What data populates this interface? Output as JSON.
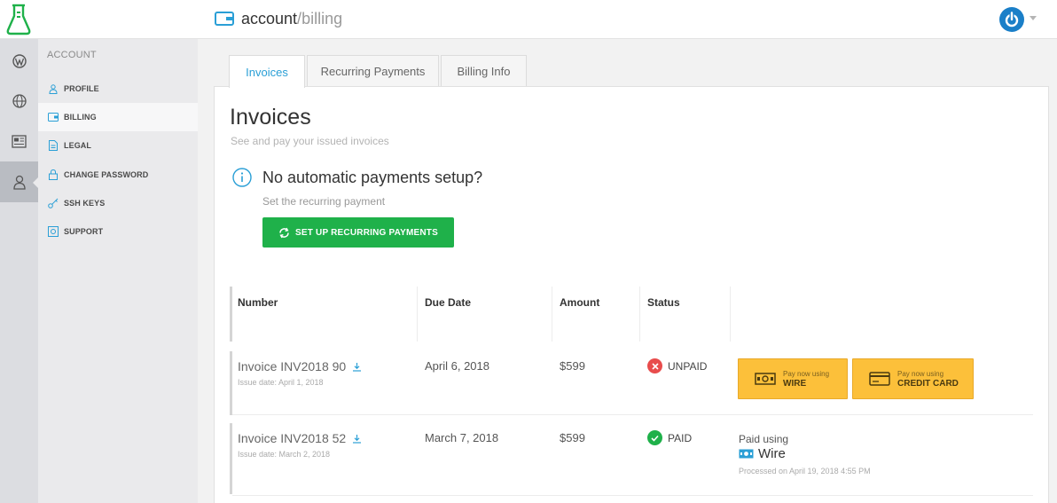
{
  "header": {
    "breadcrumb_main": "account",
    "breadcrumb_sep": "/",
    "breadcrumb_sub": "billing"
  },
  "submenu": {
    "title": "ACCOUNT",
    "items": [
      {
        "label": "PROFILE"
      },
      {
        "label": "BILLING"
      },
      {
        "label": "LEGAL"
      },
      {
        "label": "CHANGE PASSWORD"
      },
      {
        "label": "SSH KEYS"
      },
      {
        "label": "SUPPORT"
      }
    ],
    "active": "BILLING"
  },
  "tabs": [
    {
      "label": "Invoices"
    },
    {
      "label": "Recurring Payments"
    },
    {
      "label": "Billing Info"
    }
  ],
  "main": {
    "title": "Invoices",
    "subtitle": "See and pay your issued invoices",
    "notice_title": "No automatic payments setup?",
    "notice_sub": "Set the recurring payment",
    "setup_button": "SET UP RECURRING PAYMENTS"
  },
  "table": {
    "headers": [
      "Number",
      "Due Date",
      "Amount",
      "Status"
    ],
    "rows": [
      {
        "number": "Invoice INV2018 90",
        "issue": "Issue date: April 1, 2018",
        "due": "April 6, 2018",
        "amount": "$599",
        "status": "UNPAID"
      },
      {
        "number": "Invoice INV2018 52",
        "issue": "Issue date: March 2, 2018",
        "due": "March 7, 2018",
        "amount": "$599",
        "status": "PAID"
      }
    ]
  },
  "payment": {
    "wire_small": "Pay now using",
    "wire_big": "WIRE",
    "card_small": "Pay now using",
    "card_big": "CREDIT CARD",
    "paid_using": "Paid using",
    "paid_method": "Wire",
    "processed": "Processed on April 19, 2018 4:55 PM"
  },
  "colors": {
    "accent": "#2a9fd6",
    "green": "#1fb14a",
    "yellow": "#fcc03a",
    "unpaid": "#e84c4c",
    "paid": "#1fb14a",
    "power": "#1a7fc8"
  }
}
